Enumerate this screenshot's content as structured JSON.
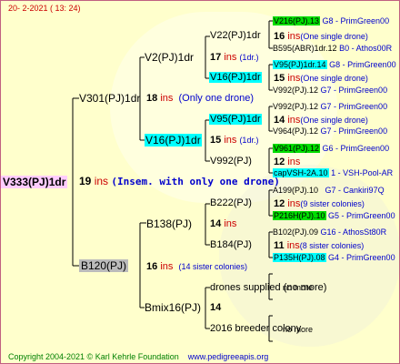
{
  "header": {
    "date": "20-   2-2021  (  13:  24)"
  },
  "footer": {
    "copyright": "Copyright 2004-2021 © Karl Kehrle Foundation",
    "site": "www.pedigreeapis.org"
  },
  "root": {
    "label": "V333(PJ)1dr",
    "count": "19",
    "ins": "ins",
    "note": "(Insem. with only one drone)"
  },
  "gen1": [
    {
      "label": "V301(PJ)1dr",
      "count": "18",
      "ins": "ins",
      "note": "(Only one drone)"
    },
    {
      "label": "B120(PJ)",
      "count": "16",
      "ins": "ins",
      "note": "(14 sister colonies)"
    }
  ],
  "gen2": [
    {
      "label": "V2(PJ)1dr",
      "count": "17",
      "ins": "ins",
      "note": "(1dr.)"
    },
    {
      "label": "V16(PJ)1dr",
      "count": "15",
      "ins": "ins",
      "note": "(1dr.)"
    },
    {
      "label": "B138(PJ)",
      "count": "14",
      "ins": "ins",
      "note": ""
    },
    {
      "label": "Bmix16(PJ)",
      "count": "14",
      "ins": "",
      "note": ""
    }
  ],
  "gen3": [
    {
      "label": "V22(PJ)1dr",
      "count": "16",
      "ins": "ins",
      "note": "(One single drone)"
    },
    {
      "label": "V16(PJ)1dr",
      "count": "15",
      "ins": "ins",
      "note": "(One single drone)"
    },
    {
      "label": "V95(PJ)1dr",
      "count": "14",
      "ins": "ins",
      "note": "(One single drone)"
    },
    {
      "label": "V992(PJ)",
      "count": "12",
      "ins": "ins",
      "note": ""
    },
    {
      "label": "B222(PJ)",
      "count": "12",
      "ins": "ins",
      "note": "(9 sister colonies)"
    },
    {
      "label": "B184(PJ)",
      "count": "11",
      "ins": "ins",
      "note": "(8 sister colonies)"
    },
    {
      "label": "drones supplied (no more)",
      "count": "",
      "ins": "",
      "note": ""
    },
    {
      "label": "2016 breeder colony",
      "count": "",
      "ins": "",
      "note": ""
    }
  ],
  "gen4": [
    {
      "label": "V216(PJ).13",
      "src": "G8 - PrimGreen00"
    },
    {
      "label": "B595(ABR)1dr.12",
      "src": "B0 - Athos00R"
    },
    {
      "label": "V95(PJ)1dr.14",
      "src": "G8 - PrimGreen00"
    },
    {
      "label": "V992(PJ).12",
      "src": "G7 - PrimGreen00"
    },
    {
      "label": "V992(PJ).12",
      "src": "G7 - PrimGreen00"
    },
    {
      "label": "V964(PJ).12",
      "src": "G7 - PrimGreen00"
    },
    {
      "label": "V961(PJ).12",
      "src": "G6 - PrimGreen00"
    },
    {
      "label": "capVSH-2A.10",
      "src": "1 - VSH-Pool-AR"
    },
    {
      "label": "A199(PJ).10",
      "src": "G7 - Cankiri97Q"
    },
    {
      "label": "P216H(PJ).10",
      "src": "G5 - PrimGreen00"
    },
    {
      "label": "B102(PJ).09",
      "src": "G16 - AthosSt80R"
    },
    {
      "label": "P135H(PJ).08",
      "src": "G4 - PrimGreen00"
    },
    {
      "label": "no more",
      "src": ""
    },
    {
      "label": "no more",
      "src": ""
    }
  ]
}
